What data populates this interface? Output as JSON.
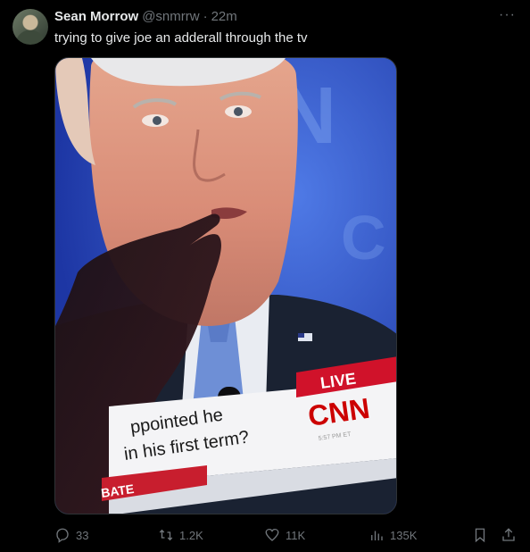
{
  "tweet": {
    "author_name": "Sean Morrow",
    "handle": "@snmrrw",
    "separator": "·",
    "time": "22m",
    "text": "trying to give joe an adderall through the tv",
    "more_label": "···"
  },
  "media": {
    "live_badge": "LIVE",
    "network_logo": "CNN",
    "chyron_line1": "ppointed he",
    "chyron_line2": "in his first term?",
    "chyron_small": "5:57 PM ET",
    "lower_label": "BATE",
    "colors": {
      "background_blue": "#2f53c4",
      "live_red": "#d0122a",
      "cnn_red": "#cc0000"
    }
  },
  "actions": {
    "replies": "33",
    "reposts": "1.2K",
    "likes": "11K",
    "views": "135K"
  },
  "icons": [
    "reply-icon",
    "repost-icon",
    "like-icon",
    "views-icon",
    "bookmark-icon",
    "share-icon"
  ]
}
